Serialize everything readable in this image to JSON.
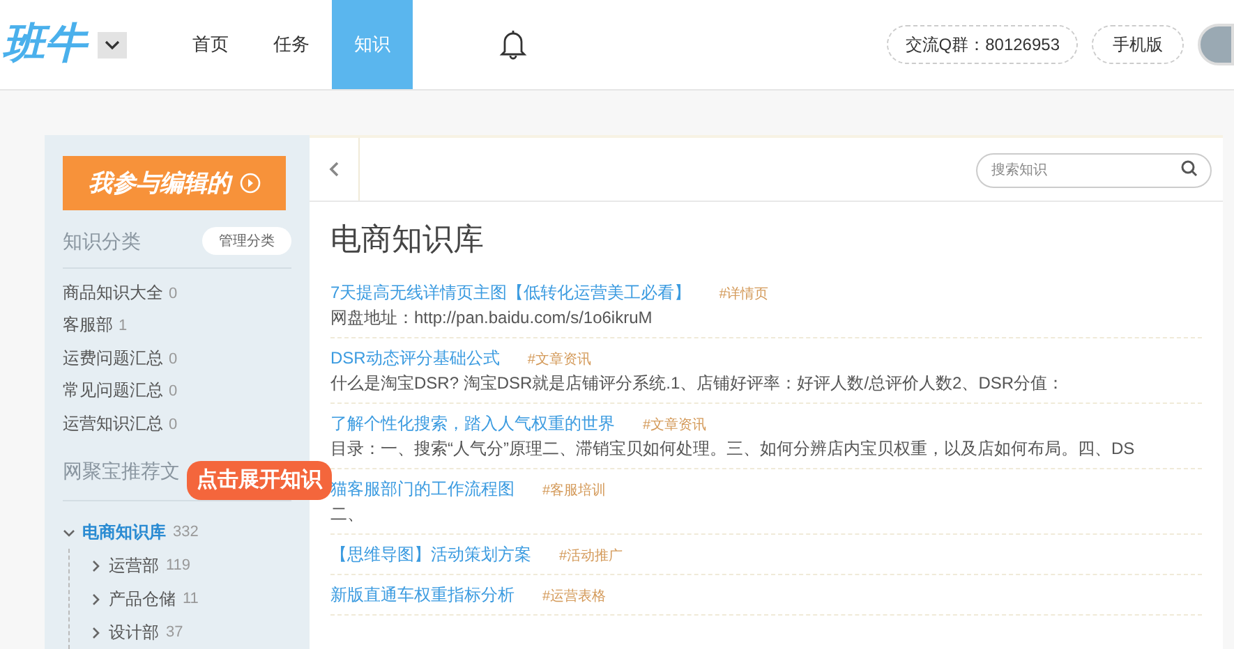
{
  "header": {
    "logo": "班牛",
    "nav": [
      {
        "label": "首页",
        "selected": false
      },
      {
        "label": "任务",
        "selected": false
      },
      {
        "label": "知识",
        "selected": true
      }
    ],
    "qq_group": "交流Q群：80126953",
    "mobile": "手机版"
  },
  "sidebar": {
    "edit_button": "我参与编辑的",
    "categories_title": "知识分类",
    "manage_button": "管理分类",
    "categories": [
      {
        "label": "商品知识大全",
        "count": "0"
      },
      {
        "label": "客服部",
        "count": "1"
      },
      {
        "label": "运费问题汇总",
        "count": "0"
      },
      {
        "label": "常见问题汇总",
        "count": "0"
      },
      {
        "label": "运营知识汇总",
        "count": "0"
      }
    ],
    "recommend_title": "网聚宝推荐文",
    "tree": [
      {
        "label": "电商知识库",
        "count": "332",
        "expanded": true,
        "children": [
          {
            "label": "运营部",
            "count": "119",
            "expanded": false
          },
          {
            "label": "产品仓储",
            "count": "11",
            "expanded": false
          },
          {
            "label": "设计部",
            "count": "37",
            "expanded": false
          }
        ]
      }
    ],
    "callout": "点击展开知识"
  },
  "main": {
    "search": {
      "placeholder": "搜索知识"
    },
    "title": "电商知识库",
    "articles": [
      {
        "title": "7天提高无线详情页主图【低转化运营美工必看】",
        "tag": "#详情页",
        "summary": "网盘地址：http://pan.baidu.com/s/1o6ikruM"
      },
      {
        "title": "DSR动态评分基础公式",
        "tag": "#文章资讯",
        "summary": "什么是淘宝DSR? 淘宝DSR就是店铺评分系统.1、店铺好评率：好评人数/总评价人数2、DSR分值："
      },
      {
        "title": "了解个性化搜索，踏入人气权重的世界",
        "tag": "#文章资讯",
        "summary": "目录：一、搜索“人气分”原理二、滞销宝贝如何处理。三、如何分辨店内宝贝权重，以及店如何布局。四、DS"
      },
      {
        "title": "猫客服部门的工作流程图",
        "tag": "#客服培训",
        "summary": "二、"
      },
      {
        "title": "【思维导图】活动策划方案",
        "tag": "#活动推广"
      },
      {
        "title": "新版直通车权重指标分析",
        "tag": "#运营表格"
      }
    ]
  }
}
